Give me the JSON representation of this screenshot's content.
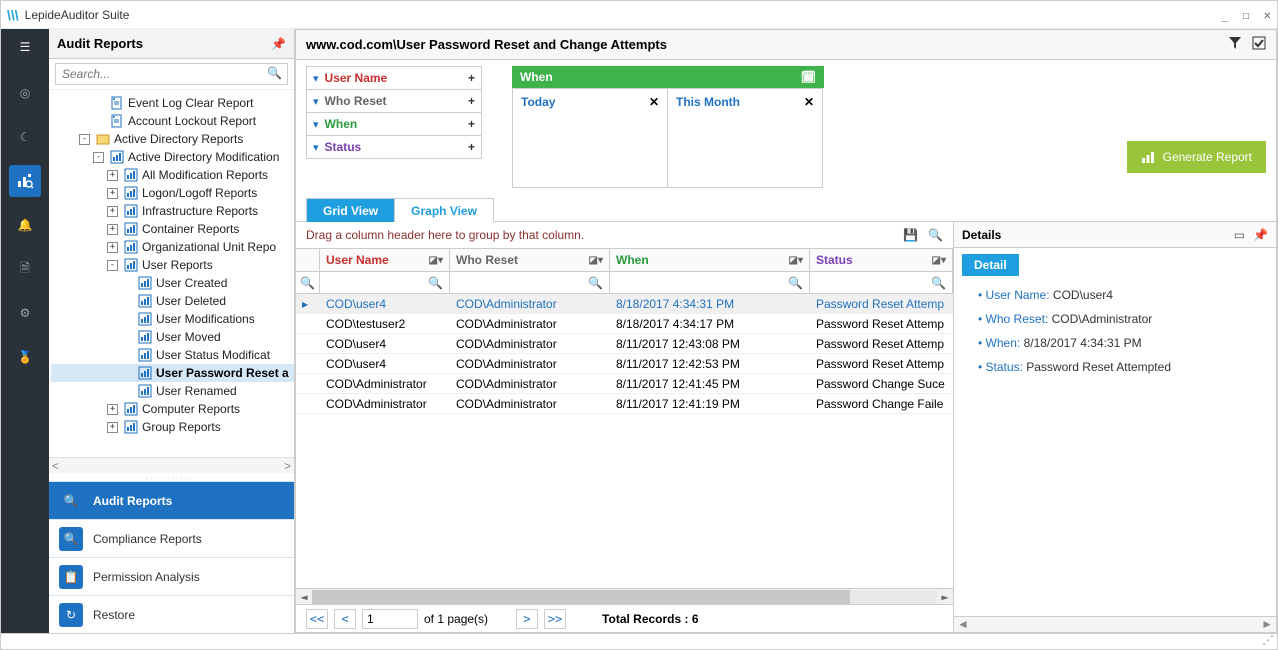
{
  "app": {
    "title": "LepideAuditor Suite",
    "window_buttons": {
      "min": "_",
      "max": "☐",
      "close": "✕"
    }
  },
  "iconbar": {
    "hamburger": "☰",
    "items": [
      "target",
      "moon",
      "analytics",
      "bell",
      "doc",
      "gear",
      "badge"
    ]
  },
  "leftpanel": {
    "title": "Audit Reports",
    "search_placeholder": "Search...",
    "tree": [
      {
        "indent": 3,
        "exp": "",
        "icon": "doc",
        "label": "Event Log Clear Report"
      },
      {
        "indent": 3,
        "exp": "",
        "icon": "doc",
        "label": "Account Lockout Report"
      },
      {
        "indent": 2,
        "exp": "-",
        "icon": "folder",
        "label": "Active Directory Reports"
      },
      {
        "indent": 3,
        "exp": "-",
        "icon": "chart",
        "label": "Active Directory Modification"
      },
      {
        "indent": 4,
        "exp": "+",
        "icon": "chart",
        "label": "All Modification Reports"
      },
      {
        "indent": 4,
        "exp": "+",
        "icon": "chart",
        "label": "Logon/Logoff Reports"
      },
      {
        "indent": 4,
        "exp": "+",
        "icon": "chart",
        "label": "Infrastructure Reports"
      },
      {
        "indent": 4,
        "exp": "+",
        "icon": "chart",
        "label": "Container Reports"
      },
      {
        "indent": 4,
        "exp": "+",
        "icon": "chart",
        "label": "Organizational Unit Repo"
      },
      {
        "indent": 4,
        "exp": "-",
        "icon": "chart",
        "label": "User Reports"
      },
      {
        "indent": 5,
        "exp": "",
        "icon": "chart",
        "label": "User Created"
      },
      {
        "indent": 5,
        "exp": "",
        "icon": "chart",
        "label": "User Deleted"
      },
      {
        "indent": 5,
        "exp": "",
        "icon": "chart",
        "label": "User Modifications"
      },
      {
        "indent": 5,
        "exp": "",
        "icon": "chart",
        "label": "User Moved"
      },
      {
        "indent": 5,
        "exp": "",
        "icon": "chart",
        "label": "User Status Modificat"
      },
      {
        "indent": 5,
        "exp": "",
        "icon": "chart",
        "label": "User Password Reset a",
        "sel": true
      },
      {
        "indent": 5,
        "exp": "",
        "icon": "chart",
        "label": "User Renamed"
      },
      {
        "indent": 4,
        "exp": "+",
        "icon": "chart",
        "label": "Computer Reports"
      },
      {
        "indent": 4,
        "exp": "+",
        "icon": "chart",
        "label": "Group Reports"
      }
    ],
    "bottomnav": [
      {
        "icon": "🔍",
        "label": "Audit Reports",
        "active": true
      },
      {
        "icon": "🔍",
        "label": "Compliance Reports"
      },
      {
        "icon": "📋",
        "label": "Permission Analysis"
      },
      {
        "icon": "↻",
        "label": "Restore"
      }
    ]
  },
  "content": {
    "title": "www.cod.com\\User Password Reset and Change Attempts",
    "header_icons": {
      "filter": "▼",
      "check": "☑"
    },
    "filter_rows": [
      {
        "label": "User Name",
        "color": "c-red"
      },
      {
        "label": "Who Reset",
        "color": "c-gray"
      },
      {
        "label": "When",
        "color": "c-green"
      },
      {
        "label": "Status",
        "color": "c-purple"
      }
    ],
    "filter_when": {
      "title": "When",
      "col1": "Today",
      "col2": "This Month"
    },
    "generate_label": "Generate Report",
    "tabs": {
      "grid": "Grid View",
      "graph": "Graph View"
    },
    "group_hint": "Drag a column header here to group by that column.",
    "columns": [
      {
        "label": "User Name",
        "color": "c-red"
      },
      {
        "label": "Who Reset",
        "color": "c-gray"
      },
      {
        "label": "When",
        "color": "c-green"
      },
      {
        "label": "Status",
        "color": "c-purple"
      }
    ],
    "rows": [
      {
        "un": "COD\\user4",
        "who": "COD\\Administrator",
        "when": "8/18/2017 4:34:31 PM",
        "st": "Password Reset Attemp",
        "sel": true
      },
      {
        "un": "COD\\testuser2",
        "who": "COD\\Administrator",
        "when": "8/18/2017 4:34:17 PM",
        "st": "Password Reset Attemp"
      },
      {
        "un": "COD\\user4",
        "who": "COD\\Administrator",
        "when": "8/11/2017 12:43:08 PM",
        "st": "Password Reset Attemp"
      },
      {
        "un": "COD\\user4",
        "who": "COD\\Administrator",
        "when": "8/11/2017 12:42:53 PM",
        "st": "Password Reset Attemp"
      },
      {
        "un": "COD\\Administrator",
        "who": "COD\\Administrator",
        "when": "8/11/2017 12:41:45 PM",
        "st": "Password Change Suce"
      },
      {
        "un": "COD\\Administrator",
        "who": "COD\\Administrator",
        "when": "8/11/2017 12:41:19 PM",
        "st": "Password Change Faile"
      }
    ],
    "pager": {
      "page": "1",
      "pages_text": "of 1 page(s)",
      "totals": "Total Records : 6"
    }
  },
  "details": {
    "title": "Details",
    "tab": "Detail",
    "fields": [
      {
        "label": "User Name:",
        "value": "COD\\user4"
      },
      {
        "label": "Who Reset:",
        "value": "COD\\Administrator"
      },
      {
        "label": "When:",
        "value": "8/18/2017 4:34:31 PM"
      },
      {
        "label": "Status:",
        "value": "Password Reset Attempted"
      }
    ]
  }
}
